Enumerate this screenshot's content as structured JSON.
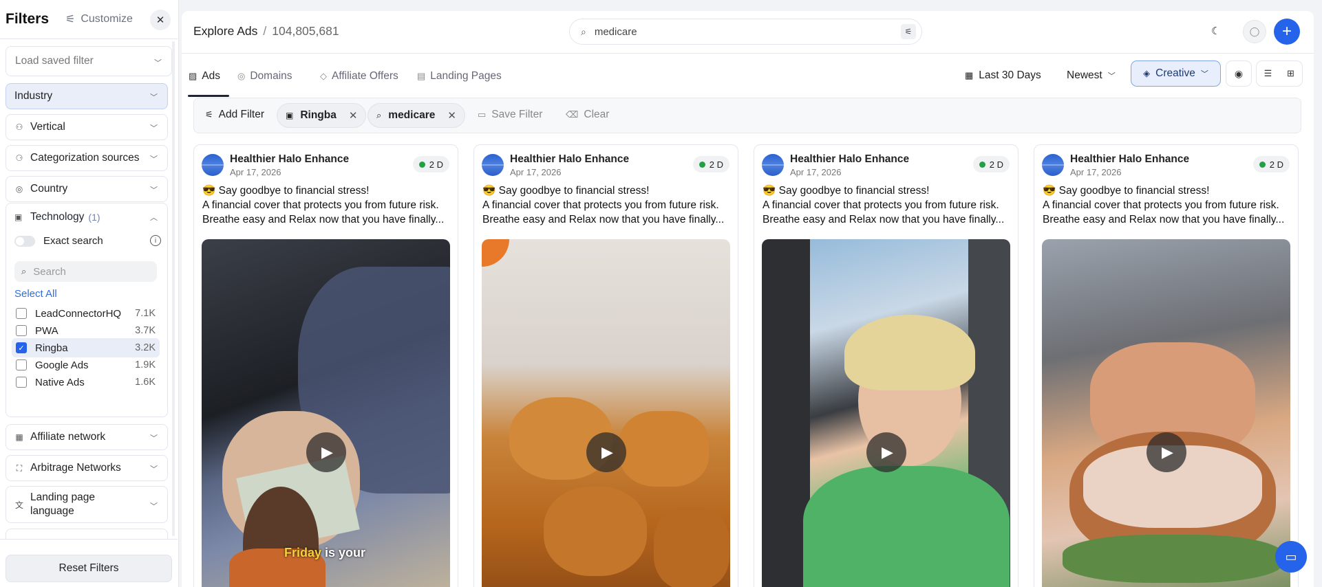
{
  "sidebar": {
    "title": "Filters",
    "customize_label": "Customize",
    "load_saved_placeholder": "Load saved filter",
    "sections": {
      "industry": "Industry",
      "vertical": "Vertical",
      "categorization": "Categorization sources",
      "country": "Country",
      "technology": "Technology",
      "technology_count": "(1)",
      "affiliate": "Affiliate network",
      "arbitrage": "Arbitrage Networks",
      "landing_lang_1": "Landing page",
      "landing_lang_2": "language"
    },
    "exact_search_label": "Exact search",
    "search_placeholder": "Search",
    "select_all": "Select All",
    "options": [
      {
        "label": "LeadConnectorHQ",
        "count": "7.1K",
        "checked": false
      },
      {
        "label": "PWA",
        "count": "3.7K",
        "checked": false
      },
      {
        "label": "Ringba",
        "count": "3.2K",
        "checked": true
      },
      {
        "label": "Google Ads",
        "count": "1.9K",
        "checked": false
      },
      {
        "label": "Native Ads",
        "count": "1.6K",
        "checked": false
      }
    ],
    "reset_label": "Reset Filters"
  },
  "header": {
    "breadcrumb": "Explore Ads",
    "separator": "/",
    "total": "104,805,681",
    "search_value": "medicare"
  },
  "tabs": [
    {
      "label": "Ads",
      "icon": "image-icon"
    },
    {
      "label": "Domains",
      "icon": "globe-icon"
    },
    {
      "label": "Affiliate Offers",
      "icon": "tag-icon"
    },
    {
      "label": "Landing Pages",
      "icon": "page-icon"
    }
  ],
  "controls": {
    "date_range": "Last 30 Days",
    "sort": "Newest",
    "view_mode": "Creative"
  },
  "filterbar": {
    "add_filter": "Add Filter",
    "chips": [
      "Ringba",
      "medicare"
    ],
    "save_filter": "Save Filter",
    "clear": "Clear"
  },
  "cards": [
    {
      "advertiser": "Healthier Halo Enhance",
      "date": "Apr 17, 2026",
      "badge": "2 D",
      "line1": "😎 Say goodbye to financial stress!",
      "line2": "A financial cover that protects you from future risk.",
      "line3": "Breathe easy and Relax now that you have finally...",
      "caption_hl": "Friday",
      "caption_rest": " is your"
    },
    {
      "advertiser": "Healthier Halo Enhance",
      "date": "Apr 17, 2026",
      "badge": "2 D",
      "line1": "😎 Say goodbye to financial stress!",
      "line2": "A financial cover that protects you from future risk.",
      "line3": "Breathe easy and Relax now that you have finally..."
    },
    {
      "advertiser": "Healthier Halo Enhance",
      "date": "Apr 17, 2026",
      "badge": "2 D",
      "line1": "😎 Say goodbye to financial stress!",
      "line2": "A financial cover that protects you from future risk.",
      "line3": "Breathe easy and Relax now that you have finally..."
    },
    {
      "advertiser": "Healthier Halo Enhance",
      "date": "Apr 17, 2026",
      "badge": "2 D",
      "line1": "😎 Say goodbye to financial stress!",
      "line2": "A financial cover that protects you from future risk.",
      "line3": "Breathe easy and Relax now that you have finally..."
    }
  ],
  "colors": {
    "accent": "#2563eb",
    "active_badge_dot": "#22a045"
  }
}
